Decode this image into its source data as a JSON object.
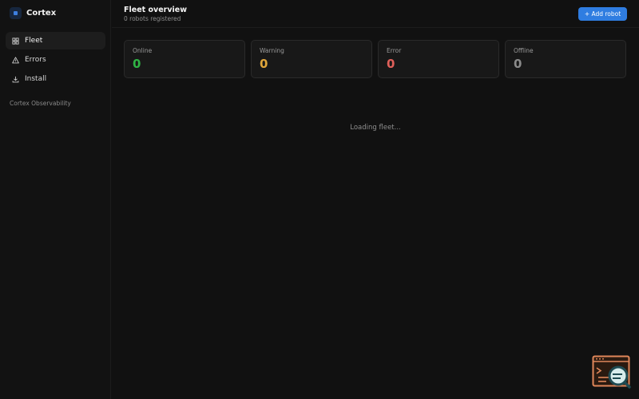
{
  "brand": {
    "name": "Cortex",
    "logo_icon": "cube-icon"
  },
  "sidebar": {
    "items": [
      {
        "label": "Fleet",
        "icon": "grid-icon",
        "active": true
      },
      {
        "label": "Errors",
        "icon": "warning-icon",
        "active": false
      },
      {
        "label": "Install",
        "icon": "download-icon",
        "active": false
      }
    ],
    "footer": "Cortex Observability"
  },
  "header": {
    "title": "Fleet overview",
    "subtitle": "0 robots registered",
    "add_button_label": "+ Add robot"
  },
  "stats": [
    {
      "label": "Online",
      "value": "0",
      "color": "#2fb344"
    },
    {
      "label": "Warning",
      "value": "0",
      "color": "#e0a63a"
    },
    {
      "label": "Error",
      "value": "0",
      "color": "#e0605a"
    },
    {
      "label": "Offline",
      "value": "0",
      "color": "#8a8a8a"
    }
  ],
  "status": {
    "loading_text": "Loading fleet..."
  },
  "colors": {
    "accent": "#2f7de1",
    "background": "#111111",
    "card": "#181818"
  }
}
